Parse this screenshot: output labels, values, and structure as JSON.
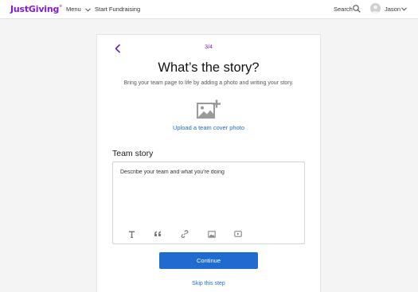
{
  "header": {
    "logo": "JustGiving",
    "logo_mark": "®",
    "menu_label": "Menu",
    "start_fundraising_label": "Start Fundraising",
    "search_label": "Search",
    "user_name": "Jason"
  },
  "page": {
    "step": "3/4",
    "title": "What’s the story?",
    "subtitle": "Bring your team page to life by adding a photo and writing your story.",
    "upload_label": "Upload a team cover photo",
    "story_label": "Team story",
    "story_placeholder": "Describe your team and what you're doing",
    "story_value": "",
    "toolbar": {
      "icons": [
        "text-format-icon",
        "quote-icon",
        "link-icon",
        "image-icon",
        "video-icon"
      ]
    },
    "continue_label": "Continue",
    "skip_label": "Skip this step"
  },
  "colors": {
    "brand": "#8a17d6",
    "primary": "#1f6bd0",
    "background": "#f4f4f4"
  }
}
